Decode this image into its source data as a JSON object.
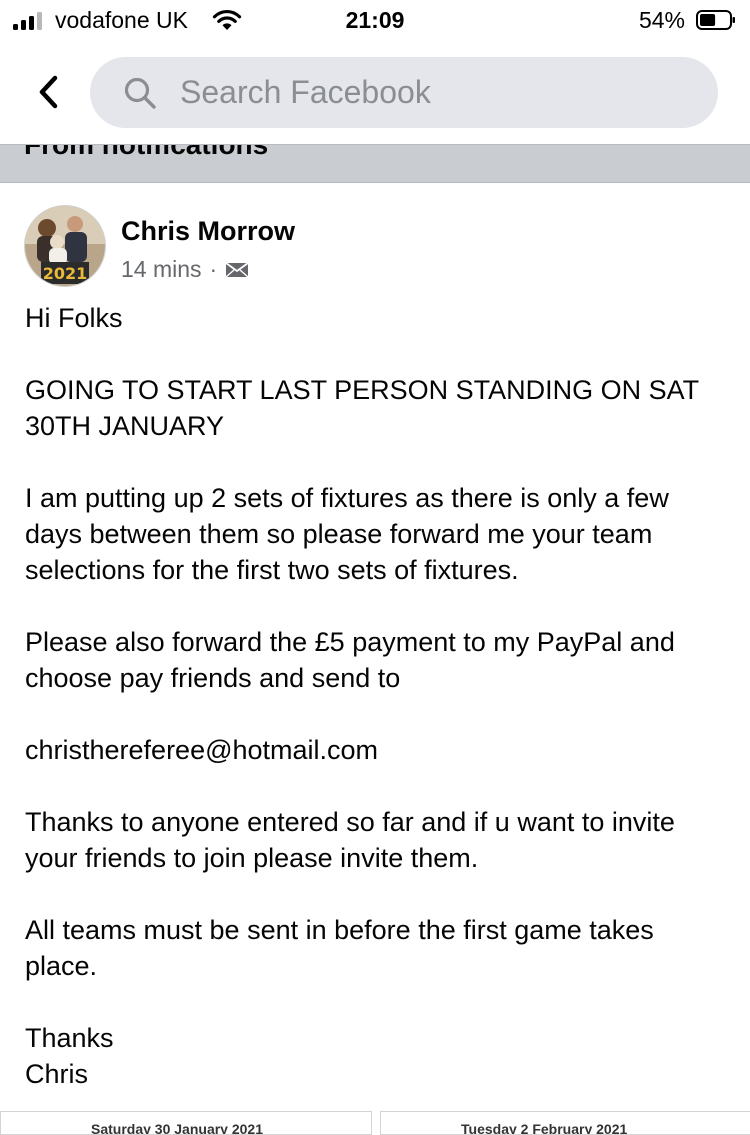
{
  "status_bar": {
    "carrier": "vodafone UK",
    "time": "21:09",
    "battery_percent": "54%",
    "signal_bars_filled": 3,
    "signal_bars_total": 4,
    "battery_level": 0.54
  },
  "header": {
    "back_icon": "chevron-left-icon",
    "search_placeholder": "Search Facebook"
  },
  "notification_strip": {
    "label": "From notifications"
  },
  "post": {
    "author": "Chris Morrow",
    "time": "14 mins",
    "separator": "·",
    "audience_icon": "envelope-icon",
    "avatar_badge": "2021",
    "body": [
      "Hi Folks",
      "GOING TO START LAST PERSON STANDING ON SAT 30TH JANUARY",
      "I am putting up 2 sets of fixtures as there is only a few days between them so please forward me your team selections for the first two sets of fixtures.",
      "Please also forward the £5 payment to my PayPal and choose pay friends and send to",
      "christhereferee@hotmail.com",
      "Thanks to anyone entered so far and if u want to invite your friends to join please invite them.",
      "All teams must be sent in before the first game takes place.",
      "Thanks",
      "Chris"
    ],
    "attachments": [
      {
        "title": "Saturday 30 January 2021"
      },
      {
        "title": "Tuesday 2 February 2021"
      }
    ]
  },
  "colors": {
    "search_bg": "#e4e6eb",
    "strip_bg": "#c9ccd1",
    "meta_text": "#65676b"
  }
}
